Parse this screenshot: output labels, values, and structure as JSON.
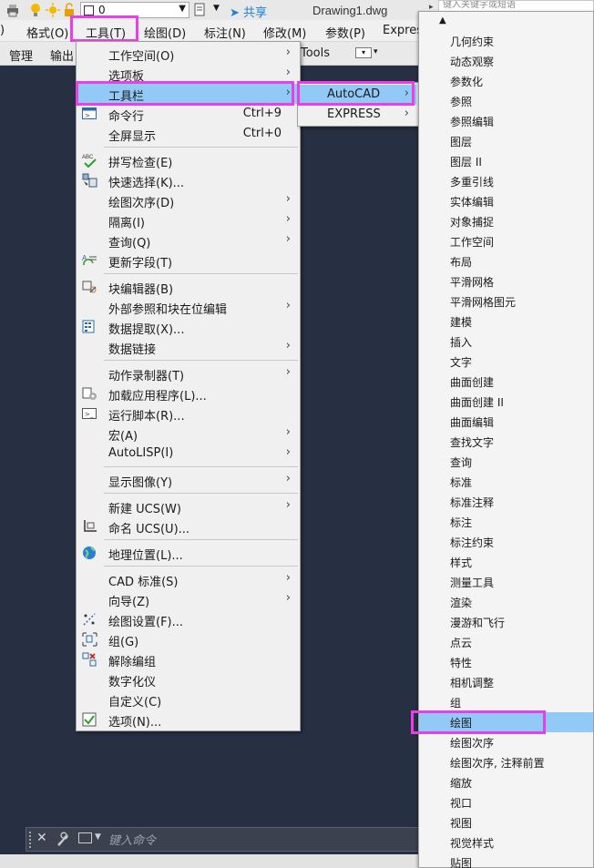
{
  "window": {
    "layer_value": "0",
    "share_label": "共享",
    "document_title": "Drawing1.dwg",
    "search_placeholder": "键入关键字或短语"
  },
  "menubar": {
    "items": [
      ")",
      "格式(O)",
      "工具(T)",
      "绘图(D)",
      "标注(N)",
      "修改(M)",
      "参数(P)",
      "Express"
    ]
  },
  "ribbon": {
    "tabs": [
      "管理",
      "输出",
      "Tools"
    ]
  },
  "tools_menu": {
    "items": [
      {
        "label": "工作空间(O)",
        "icon": "",
        "shortcut": "",
        "submenu": true
      },
      {
        "label": "选项板",
        "icon": "",
        "shortcut": "",
        "submenu": true
      },
      {
        "label": "工具栏",
        "icon": "",
        "shortcut": "",
        "submenu": true,
        "selected": true
      },
      {
        "label": "命令行",
        "icon": "command-line-icon",
        "shortcut": "Ctrl+9",
        "submenu": false
      },
      {
        "label": "全屏显示",
        "icon": "",
        "shortcut": "Ctrl+0",
        "submenu": false
      },
      {
        "label": "拼写检查(E)",
        "icon": "spell-check-icon",
        "shortcut": "",
        "submenu": false
      },
      {
        "label": "快速选择(K)...",
        "icon": "quick-select-icon",
        "shortcut": "",
        "submenu": false
      },
      {
        "label": "绘图次序(D)",
        "icon": "",
        "shortcut": "",
        "submenu": true
      },
      {
        "label": "隔离(I)",
        "icon": "",
        "shortcut": "",
        "submenu": true
      },
      {
        "label": "查询(Q)",
        "icon": "",
        "shortcut": "",
        "submenu": true
      },
      {
        "label": "更新字段(T)",
        "icon": "update-field-icon",
        "shortcut": "",
        "submenu": false
      },
      {
        "label": "块编辑器(B)",
        "icon": "block-editor-icon",
        "shortcut": "",
        "submenu": false
      },
      {
        "label": "外部参照和块在位编辑",
        "icon": "",
        "shortcut": "",
        "submenu": true
      },
      {
        "label": "数据提取(X)...",
        "icon": "data-extraction-icon",
        "shortcut": "",
        "submenu": false
      },
      {
        "label": "数据链接",
        "icon": "",
        "shortcut": "",
        "submenu": true
      },
      {
        "label": "动作录制器(T)",
        "icon": "",
        "shortcut": "",
        "submenu": true
      },
      {
        "label": "加载应用程序(L)...",
        "icon": "load-application-icon",
        "shortcut": "",
        "submenu": false
      },
      {
        "label": "运行脚本(R)...",
        "icon": "run-script-icon",
        "shortcut": "",
        "submenu": false
      },
      {
        "label": "宏(A)",
        "icon": "",
        "shortcut": "",
        "submenu": true
      },
      {
        "label": "AutoLISP(I)",
        "icon": "",
        "shortcut": "",
        "submenu": true
      },
      {
        "label": "显示图像(Y)",
        "icon": "",
        "shortcut": "",
        "submenu": true
      },
      {
        "label": "新建 UCS(W)",
        "icon": "",
        "shortcut": "",
        "submenu": true
      },
      {
        "label": "命名 UCS(U)...",
        "icon": "named-ucs-icon",
        "shortcut": "",
        "submenu": false
      },
      {
        "label": "地理位置(L)...",
        "icon": "globe-icon",
        "shortcut": "",
        "submenu": false
      },
      {
        "label": "CAD 标准(S)",
        "icon": "",
        "shortcut": "",
        "submenu": true
      },
      {
        "label": "向导(Z)",
        "icon": "",
        "shortcut": "",
        "submenu": true
      },
      {
        "label": "绘图设置(F)...",
        "icon": "drafting-settings-icon",
        "shortcut": "",
        "submenu": false
      },
      {
        "label": "组(G)",
        "icon": "group-icon",
        "shortcut": "",
        "submenu": false
      },
      {
        "label": "解除编组",
        "icon": "ungroup-icon",
        "shortcut": "",
        "submenu": false
      },
      {
        "label": "数字化仪",
        "icon": "",
        "shortcut": "",
        "submenu": false
      },
      {
        "label": "自定义(C)",
        "icon": "",
        "shortcut": "",
        "submenu": false
      },
      {
        "label": "选项(N)...",
        "icon": "checkmark-icon",
        "shortcut": "",
        "submenu": false
      }
    ]
  },
  "toolbar_submenu": {
    "items": [
      {
        "label": "AutoCAD",
        "selected": true
      },
      {
        "label": "EXPRESS",
        "selected": false
      }
    ]
  },
  "autocad_toolbars": {
    "items": [
      "几何约束",
      "动态观察",
      "参数化",
      "参照",
      "参照编辑",
      "图层",
      "图层 II",
      "多重引线",
      "实体编辑",
      "对象捕捉",
      "工作空间",
      "布局",
      "平滑网格",
      "平滑网格图元",
      "建模",
      "插入",
      "文字",
      "曲面创建",
      "曲面创建 II",
      "曲面编辑",
      "查找文字",
      "查询",
      "标准",
      "标准注释",
      "标注",
      "标注约束",
      "样式",
      "测量工具",
      "渲染",
      "漫游和飞行",
      "点云",
      "特性",
      "相机调整",
      "组",
      "绘图",
      "绘图次序",
      "绘图次序, 注释前置",
      "缩放",
      "视口",
      "视图",
      "视觉样式",
      "贴图"
    ],
    "selected_index": 34
  },
  "command_line": {
    "placeholder": "键入命令"
  },
  "colors": {
    "highlight": "#91c9f7",
    "annotation_box": "#e640e6",
    "canvas": "#263042"
  }
}
